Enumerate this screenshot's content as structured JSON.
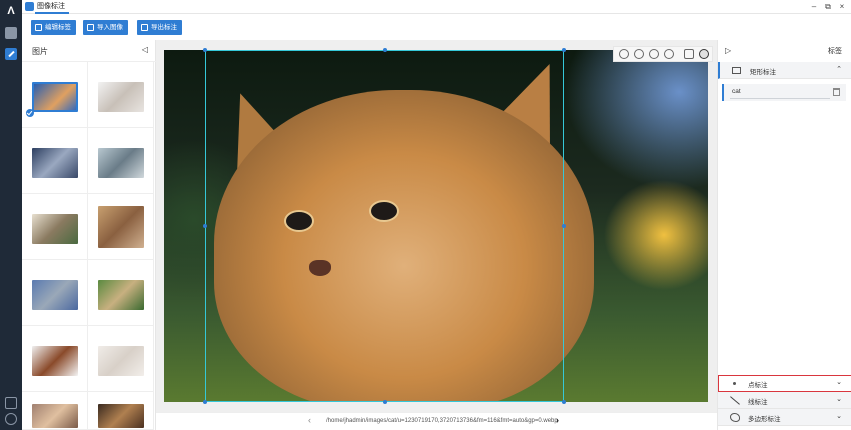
{
  "app": {
    "title": "图像标注"
  },
  "window_controls": {
    "minimize": "–",
    "restore": "⧉",
    "close": "×"
  },
  "toolbar": {
    "edit_labels": "编辑标签",
    "import_images": "导入图像",
    "export_annotations": "导出标注"
  },
  "images_panel": {
    "title": "图片",
    "collapse": "◁",
    "thumbnails": [
      {
        "icon": "cat-thumbnail",
        "selected": true
      },
      {
        "icon": "cat-thumbnail",
        "selected": false
      },
      {
        "icon": "cat-thumbnail",
        "selected": false
      },
      {
        "icon": "cat-thumbnail",
        "selected": false
      },
      {
        "icon": "cat-thumbnail",
        "selected": false
      },
      {
        "icon": "cat-thumbnail",
        "selected": false
      },
      {
        "icon": "cat-thumbnail",
        "selected": false
      },
      {
        "icon": "cat-thumbnail",
        "selected": false
      },
      {
        "icon": "cat-thumbnail",
        "selected": false
      },
      {
        "icon": "cat-thumbnail",
        "selected": false
      },
      {
        "icon": "cat-thumbnail",
        "selected": false
      },
      {
        "icon": "cat-thumbnail",
        "selected": false
      }
    ]
  },
  "canvas": {
    "path": "/home/jhadmin/images/cat/u=1230719170,3720713736&fm=116&fmt=auto&gp=0.webp",
    "prev": "‹",
    "next": "›"
  },
  "labels_panel": {
    "title": "标签",
    "collapse": "▷",
    "sections": {
      "rect": {
        "label": "矩形标注",
        "chevron": "⌃"
      },
      "point": {
        "label": "点标注",
        "chevron": "⌄"
      },
      "line": {
        "label": "线标注",
        "chevron": "⌄"
      },
      "polygon": {
        "label": "多边形标注",
        "chevron": "⌄"
      }
    },
    "rect_items": [
      {
        "text": "cat"
      }
    ]
  },
  "colors": {
    "accent": "#2f7dd3",
    "bbox": "#35c8d8",
    "highlight": "#d9363e",
    "rail": "#1f2a38"
  }
}
